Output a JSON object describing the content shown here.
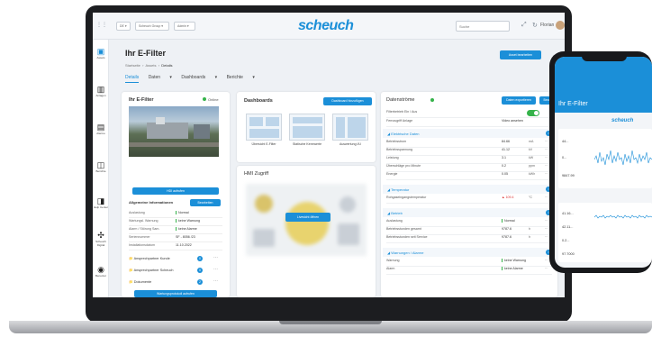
{
  "topbar": {
    "select1": "DE",
    "select2": "Scheuch Group",
    "select3": "Admin",
    "logo": "scheuch",
    "search_placeholder": "Suche",
    "user": "Florian"
  },
  "nav": [
    {
      "label": "Assets",
      "icon": "cube-icon"
    },
    {
      "label": "Anlagen",
      "icon": "plant-icon"
    },
    {
      "label": "Alarme",
      "icon": "bell-icon"
    },
    {
      "label": "Berichte",
      "icon": "report-icon"
    },
    {
      "label": "Help Center",
      "icon": "help-icon"
    },
    {
      "label": "Scheuch Digital",
      "icon": "digital-icon"
    },
    {
      "label": "Benutzer",
      "icon": "user-icon"
    }
  ],
  "page": {
    "title": "Ihr E-Filter",
    "breadcrumb": [
      "Startseite",
      "Assets",
      "Details"
    ],
    "tabs": [
      "Details",
      "Daten",
      "Dashboards",
      "Berichte"
    ],
    "edit_button": "Asset bearbeiten"
  },
  "filter_card": {
    "title": "Ihr E-Filter",
    "status": "Online",
    "hdi_button": "HDI aufrufen",
    "general_info": "Allgemeine Informationen",
    "edit": "Bearbeiten",
    "rows": [
      {
        "label": "Auslastung",
        "value": "Normal"
      },
      {
        "label": "Wartungsl. Warnung",
        "value": "keine Warnung"
      },
      {
        "label": "Alarm / Störung Sam.",
        "value": "keine Alarme"
      },
      {
        "label": "Seriennummer",
        "value": "SF - 8056 /23"
      },
      {
        "label": "Installationsdatum",
        "value": "11.10.2022"
      }
    ],
    "contacts": [
      {
        "label": "Ansprechpartner Kunde",
        "count": "0"
      },
      {
        "label": "Ansprechpartner Scheuch",
        "count": "0"
      },
      {
        "label": "Dokumente",
        "count": "2"
      }
    ],
    "maintenance_button": "Wartungsprotokoll aufrufen"
  },
  "dashboards": {
    "title": "Dashboards",
    "add_button": "Dashboard hinzufügen",
    "items": [
      "Übersicht E-Filter",
      "Statische Kennwerte",
      "Auswertung I/U"
    ]
  },
  "hmi": {
    "title": "HMI Zugriff",
    "button": "Livesicht öffnen"
  },
  "datastreams": {
    "title": "Datenströme",
    "export_button": "Daten exportieren",
    "more_button": "Bearbeiten",
    "toggle_label": "Filterbetrieb Ein / Aus",
    "remote_label": "Fernzugriff Anlage",
    "remote_value": "Video ansehen",
    "groups": [
      {
        "name": "Elektrische Daten",
        "rows": [
          {
            "label": "Betriebsstrom",
            "value": "84.66",
            "unit": "mA"
          },
          {
            "label": "Betriebsspannung",
            "value": "41.12",
            "unit": "kV"
          },
          {
            "label": "Leistung",
            "value": "3.1",
            "unit": "kW"
          },
          {
            "label": "Überschläge pro Minute",
            "value": "0.2",
            "unit": "ppm"
          },
          {
            "label": "Energie",
            "value": "0.05",
            "unit": "kWh"
          }
        ]
      },
      {
        "name": "Temperatur",
        "rows": [
          {
            "label": "Rohgaseingangstemperatur",
            "value": "109.4",
            "unit": "°C"
          }
        ]
      },
      {
        "name": "Betrieb",
        "rows": [
          {
            "label": "Auslastung",
            "value": "Normal",
            "unit": ""
          },
          {
            "label": "Betriebsstunden gesamt",
            "value": "9787.6",
            "unit": "h"
          },
          {
            "label": "Betriebsstunden seit Service",
            "value": "9787.6",
            "unit": "h"
          }
        ]
      },
      {
        "name": "Warnungen / Alarme",
        "rows": [
          {
            "label": "Warnung",
            "value": "keine Warnung",
            "unit": ""
          },
          {
            "label": "Alarm",
            "value": "keine Alarme",
            "unit": ""
          }
        ]
      }
    ]
  },
  "phone": {
    "title": "Ihr E-Filter",
    "logo": "scheuch",
    "values_top": [
      "44...",
      "0...",
      "9847.99"
    ],
    "values_bottom": [
      "41.16...",
      "42.11...",
      "0.2...",
      "97.7000"
    ]
  },
  "colors": {
    "accent": "#1b8fd8",
    "ok": "#35b34a",
    "warn": "#dd3333"
  }
}
